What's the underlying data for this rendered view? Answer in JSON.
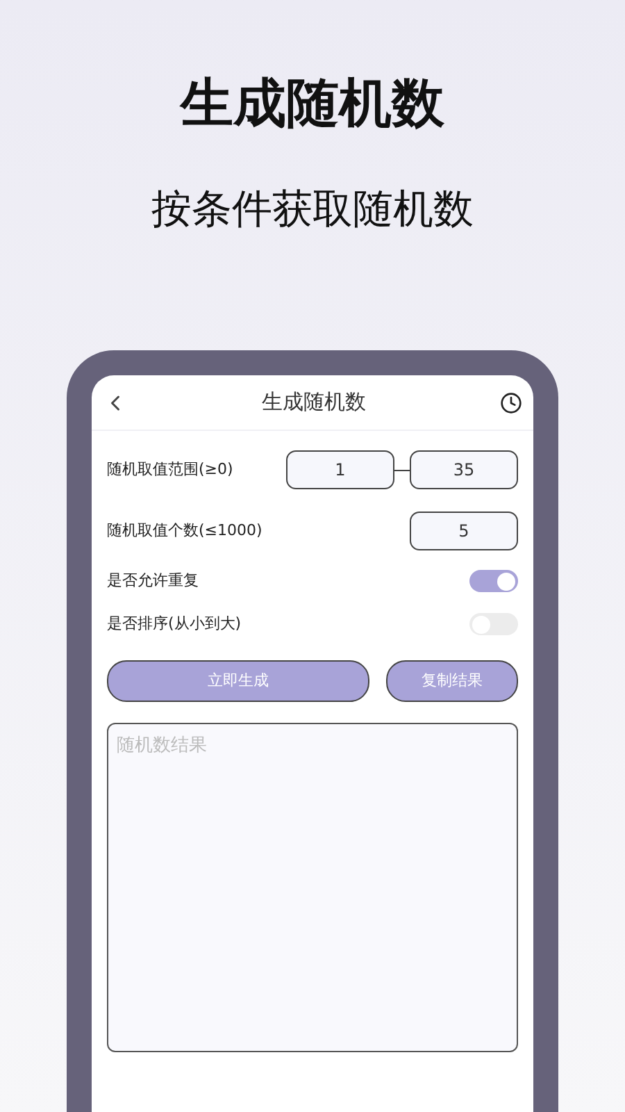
{
  "headline": "生成随机数",
  "subheadline": "按条件获取随机数",
  "app": {
    "title": "生成随机数",
    "range": {
      "label": "随机取值范围(≥0)",
      "min": "1",
      "max": "35"
    },
    "count": {
      "label": "随机取值个数(≤1000)",
      "value": "5"
    },
    "toggles": [
      {
        "label": "是否允许重复",
        "on": true
      },
      {
        "label": "是否排序(从小到大)",
        "on": false
      }
    ],
    "buttons": [
      "立即生成",
      "复制结果"
    ],
    "result": {
      "placeholder": "随机数结果"
    }
  }
}
